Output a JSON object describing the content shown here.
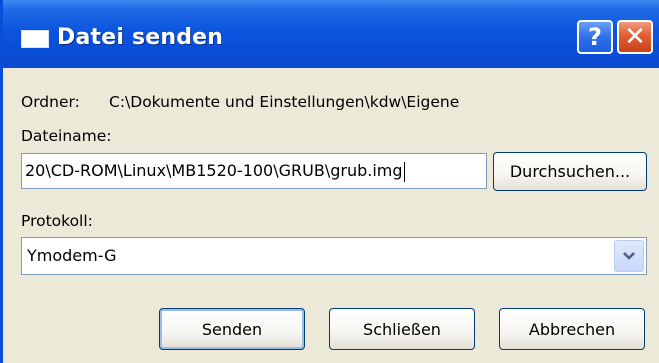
{
  "window": {
    "title": "Datei senden",
    "help_button": "?",
    "close_button": "✕"
  },
  "folder": {
    "label": "Ordner:",
    "value": "C:\\Dokumente und Einstellungen\\kdw\\Eigene"
  },
  "filename": {
    "label": "Dateiname:",
    "value": "20\\CD-ROM\\Linux\\MB1520-100\\GRUB\\grub.img",
    "browse_label": "Durchsuchen..."
  },
  "protocol": {
    "label": "Protokoll:",
    "selected": "Ymodem-G"
  },
  "buttons": {
    "send": "Senden",
    "close": "Schließen",
    "cancel": "Abbrechen"
  },
  "colors": {
    "titlebar": "#0a4ed8",
    "dialog_background": "#ece9d8",
    "close_button": "#e25d33"
  }
}
